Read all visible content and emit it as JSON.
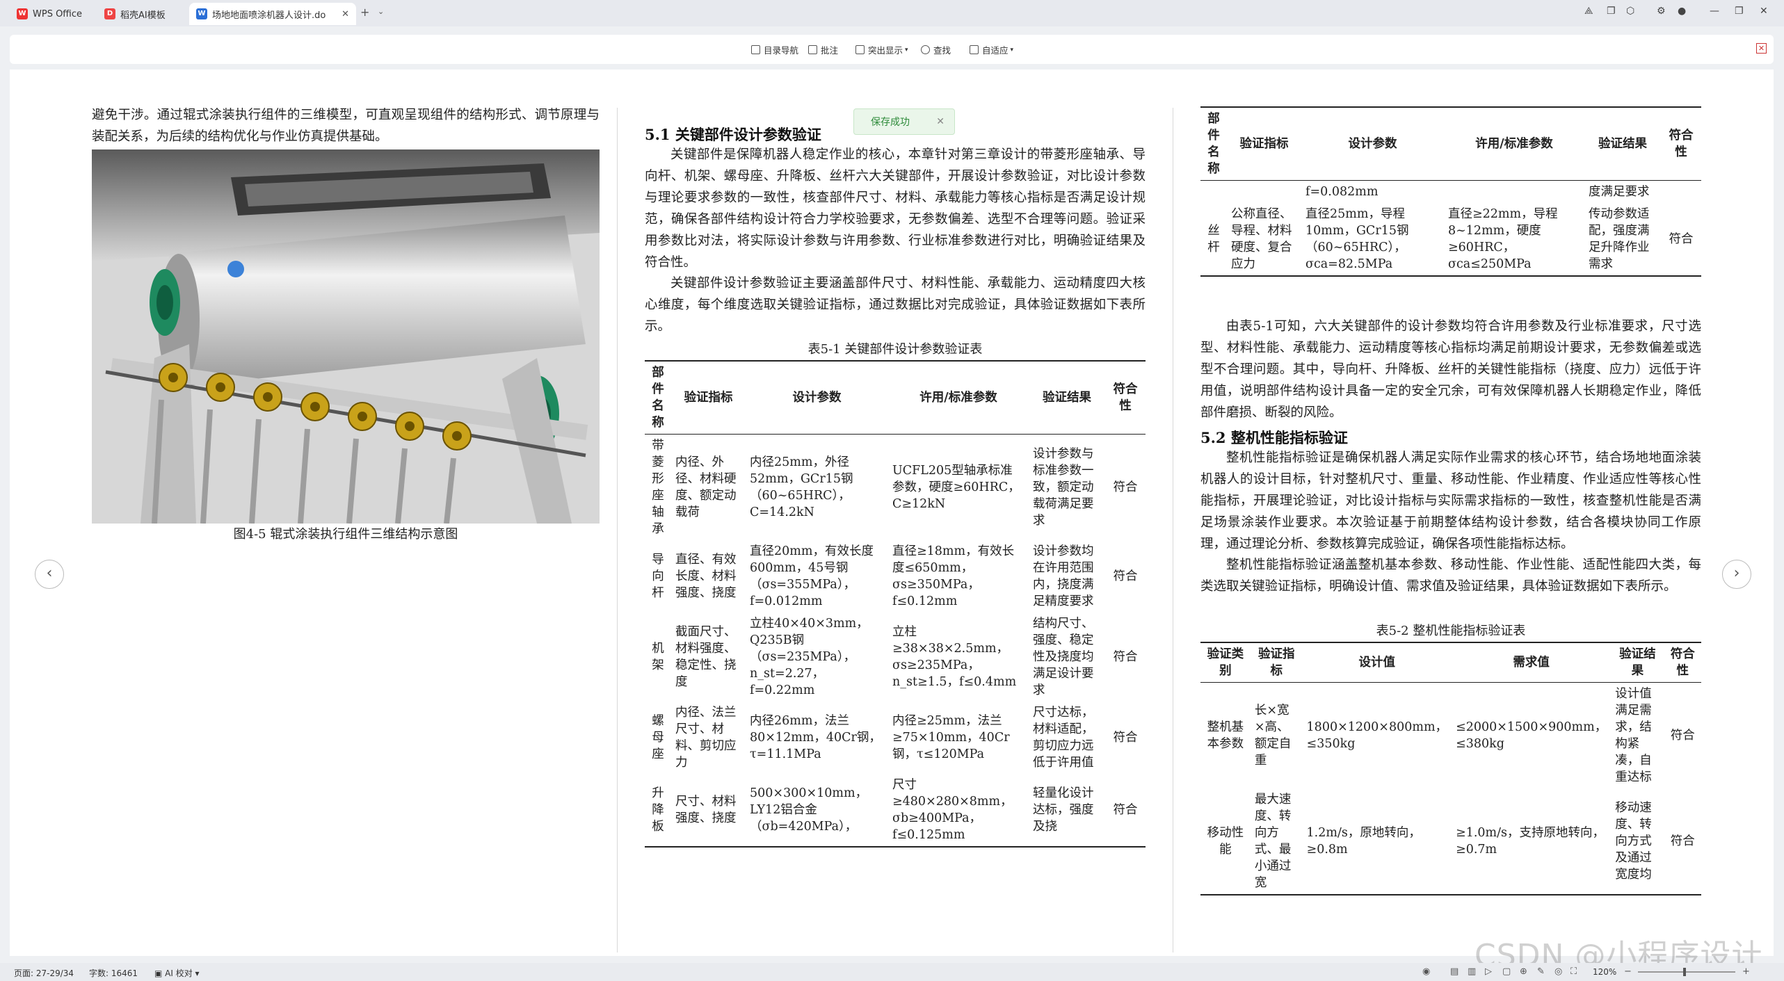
{
  "tabs": [
    {
      "label": "WPS Office",
      "icon": "wps-logo-icon"
    },
    {
      "label": "稻壳AI模板",
      "icon": "docer-icon"
    },
    {
      "label": "场地地面喷涂机器人设计.do",
      "icon": "word-doc-icon"
    }
  ],
  "toolbar": {
    "nav": "目录导航",
    "comment": "批注",
    "highlight": "突出显示",
    "find": "查找",
    "fit": "自适应"
  },
  "toast": {
    "text": "保存成功"
  },
  "page1": {
    "para": "避免干涉。通过辊式涂装执行组件的三维模型，可直观呈现组件的结构形式、调节原理与装配关系，为后续的结构优化与作业仿真提供基础。",
    "figure_caption": "图4-5 辊式涂装执行组件三维结构示意图"
  },
  "page2": {
    "heading": "5.1 关键部件设计参数验证",
    "p1": "关键部件是保障机器人稳定作业的核心，本章针对第三章设计的带菱形座轴承、导向杆、机架、螺母座、升降板、丝杆六大关键部件，开展设计参数验证，对比设计参数与理论要求参数的一致性，核查部件尺寸、材料、承载能力等核心指标是否满足设计规范，确保各部件结构设计符合力学校验要求，无参数偏差、选型不合理等问题。验证采用参数比对法，将实际设计参数与许用参数、行业标准参数进行对比，明确验证结果及符合性。",
    "p2": "关键部件设计参数验证主要涵盖部件尺寸、材料性能、承载能力、运动精度四大核心维度，每个维度选取关键验证指标，通过数据比对完成验证，具体验证数据如下表所示。",
    "table_caption": "表5-1 关键部件设计参数验证表",
    "headers": [
      "部件名称",
      "验证指标",
      "设计参数",
      "许用/标准参数",
      "验证结果",
      "符合性"
    ],
    "rows": [
      [
        "带菱形座轴承",
        "内径、外径、材料硬度、额定动载荷",
        "内径25mm，外径52mm，GCr15钢（60~65HRC），C=14.2kN",
        "UCFL205型轴承标准参数，硬度≥60HRC，C≥12kN",
        "设计参数与标准参数一致，额定动载荷满足要求",
        "符合"
      ],
      [
        "导向杆",
        "直径、有效长度、材料强度、挠度",
        "直径20mm，有效长度600mm，45号钢（σs=355MPa），f=0.012mm",
        "直径≥18mm，有效长度≤650mm，σs≥350MPa，f≤0.12mm",
        "设计参数均在许用范围内，挠度满足精度要求",
        "符合"
      ],
      [
        "机架",
        "截面尺寸、材料强度、稳定性、挠度",
        "立柱40×40×3mm，Q235B钢（σs=235MPa），n_st=2.27，f=0.22mm",
        "立柱≥38×38×2.5mm，σs≥235MPa，n_st≥1.5，f≤0.4mm",
        "结构尺寸、强度、稳定性及挠度均满足设计要求",
        "符合"
      ],
      [
        "螺母座",
        "内径、法兰尺寸、材料、剪切应力",
        "内径26mm，法兰80×12mm，40Cr钢，τ=11.1MPa",
        "内径≥25mm，法兰≥75×10mm，40Cr钢，τ≤120MPa",
        "尺寸达标，材料适配，剪切应力远低于许用值",
        "符合"
      ],
      [
        "升降板",
        "尺寸、材料强度、挠度",
        "500×300×10mm，LY12铝合金（σb=420MPa），",
        "尺寸≥480×280×8mm，σb≥400MPa，f≤0.125mm",
        "轻量化设计达标，强度及挠",
        "符合"
      ]
    ]
  },
  "page3": {
    "headers": [
      "部件名称",
      "验证指标",
      "设计参数",
      "许用/标准参数",
      "验证结果",
      "符合性"
    ],
    "rows": [
      [
        "",
        "",
        "f=0.082mm",
        "",
        "度满足要求",
        ""
      ],
      [
        "丝杆",
        "公称直径、导程、材料硬度、复合应力",
        "直径25mm，导程10mm，GCr15钢（60~65HRC），σca=82.5MPa",
        "直径≥22mm，导程8~12mm，硬度≥60HRC，σca≤250MPa",
        "传动参数适配，强度满足升降作业需求",
        "符合"
      ]
    ],
    "p1": "由表5-1可知，六大关键部件的设计参数均符合许用参数及行业标准要求，尺寸选型、材料性能、承载能力、运动精度等核心指标均满足前期设计要求，无参数偏差或选型不合理问题。其中，导向杆、升降板、丝杆的关键性能指标（挠度、应力）远低于许用值，说明部件结构设计具备一定的安全冗余，可有效保障机器人长期稳定作业，降低部件磨损、断裂的风险。",
    "heading": "5.2 整机性能指标验证",
    "p2": "整机性能指标验证是确保机器人满足实际作业需求的核心环节，结合场地地面涂装机器人的设计目标，针对整机尺寸、重量、移动性能、作业精度、作业适应性等核心性能指标，开展理论验证，对比设计指标与实际需求指标的一致性，核查整机性能是否满足场景涂装作业要求。本次验证基于前期整体结构设计参数，结合各模块协同工作原理，通过理论分析、参数核算完成验证，确保各项性能指标达标。",
    "p3": "整机性能指标验证涵盖整机基本参数、移动性能、作业性能、适配性能四大类，每类选取关键验证指标，明确设计值、需求值及验证结果，具体验证数据如下表所示。",
    "table_caption": "表5-2 整机性能指标验证表",
    "headers2": [
      "验证类别",
      "验证指标",
      "设计值",
      "需求值",
      "验证结果",
      "符合性"
    ],
    "rows2": [
      [
        "整机基本参数",
        "长×宽×高、额定自重",
        "1800×1200×800mm，≤350kg",
        "≤2000×1500×900mm，≤380kg",
        "设计值满足需求，结构紧凑，自重达标",
        "符合"
      ],
      [
        "移动性能",
        "最大速度、转向方式、最小通过宽",
        "1.2m/s，原地转向，≥0.8m",
        "≥1.0m/s，支持原地转向，≥0.7m",
        "移动速度、转向方式及通过宽度均",
        "符合"
      ]
    ]
  },
  "statusbar": {
    "page": "页面: 27-29/34",
    "words": "字数: 16461",
    "proof": "AI 校对",
    "zoom": "120%"
  },
  "watermark": "CSDN @小程序设计"
}
